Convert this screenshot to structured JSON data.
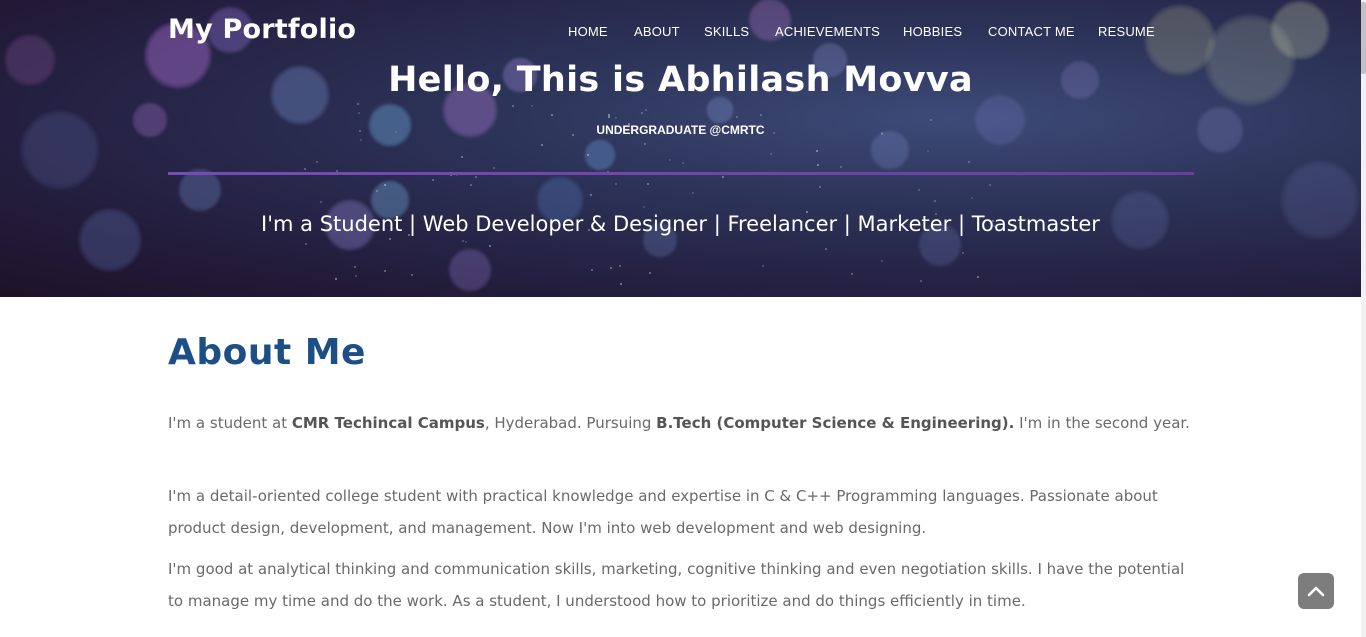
{
  "header": {
    "brand": "My Portfolio",
    "nav": [
      {
        "label": "HOME"
      },
      {
        "label": "ABOUT"
      },
      {
        "label": "SKILLS"
      },
      {
        "label": "ACHIEVEMENTS"
      },
      {
        "label": "HOBBIES"
      },
      {
        "label": "CONTACT ME"
      },
      {
        "label": "RESUME"
      }
    ]
  },
  "hero": {
    "title": "Hello, This is Abhilash Movva",
    "subtitle": "UNDERGRADUATE @CMRTC",
    "tagline": "I'm a Student | Web Developer & Designer | Freelancer | Marketer | Toastmaster",
    "accent_color": "#7a4bb5"
  },
  "about": {
    "heading": "About Me",
    "heading_color": "#1d4f86",
    "p1": {
      "t1": "I'm a student at ",
      "b1": "CMR Techincal Campus",
      "t2": ", Hyderabad. Pursuing ",
      "b2": "B.Tech (Computer Science & Engineering).",
      "t3": " I'm in the second year."
    },
    "p2": "I'm a detail-oriented college student with practical knowledge and expertise in C & C++ Programming languages. Passionate about product design, development, and management. Now I'm into web development and web designing.",
    "p3": "I'm good at analytical thinking and communication skills, marketing, cognitive thinking and even negotiation skills. I have the potential to manage my time and do the work. As a student, I understood how to prioritize and do things efficiently in time."
  },
  "icons": {
    "back_to_top": "chevron-up-icon"
  }
}
